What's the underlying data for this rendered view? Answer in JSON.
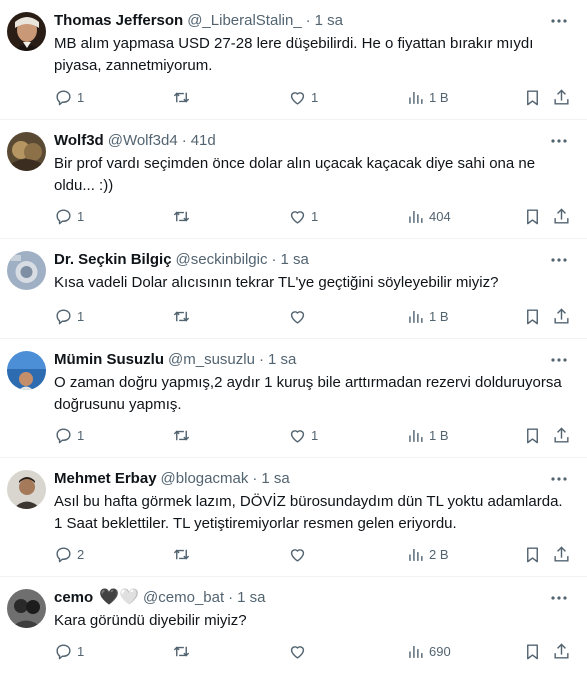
{
  "tweets": [
    {
      "name": "Thomas Jefferson",
      "handle": "@_LiberalStalin_",
      "time": "1 sa",
      "text": "MB alım yapmasa USD 27-28 lere düşebilirdi. He o fiyattan bırakır mıydı piyasa, zannetmiyorum.",
      "replies": "1",
      "retweets": "",
      "likes": "1",
      "views": "1 B"
    },
    {
      "name": "Wolf3d",
      "handle": "@Wolf3d4",
      "time": "41d",
      "text": "Bir prof vardı seçimden önce dolar alın uçacak kaçacak diye sahi ona ne oldu... :))",
      "replies": "1",
      "retweets": "",
      "likes": "1",
      "views": "404"
    },
    {
      "name": "Dr. Seçkin Bilgiç",
      "handle": "@seckinbilgic",
      "time": "1 sa",
      "text": "Kısa vadeli Dolar alıcısının tekrar TL'ye geçtiğini söyleyebilir miyiz?",
      "replies": "1",
      "retweets": "",
      "likes": "",
      "views": "1 B"
    },
    {
      "name": "Mümin Susuzlu",
      "handle": "@m_susuzlu",
      "time": "1 sa",
      "text": "O zaman doğru yapmış,2 aydır 1 kuruş bile arttırmadan rezervi dolduruyorsa doğrusunu yapmış.",
      "replies": "1",
      "retweets": "",
      "likes": "1",
      "views": "1 B"
    },
    {
      "name": "Mehmet Erbay",
      "handle": "@blogacmak",
      "time": "1 sa",
      "text": "Asıl bu hafta görmek lazım, DÖVİZ bürosundaydım dün TL yoktu adamlarda. 1 Saat beklettiler. TL yetiştiremiyorlar resmen gelen eriyordu.",
      "replies": "2",
      "retweets": "",
      "likes": "",
      "views": "2 B"
    },
    {
      "name": "cemo",
      "handle": "@cemo_bat",
      "time": "1 sa",
      "text": "Kara göründü diyebilir miyiz?",
      "replies": "1",
      "retweets": "",
      "likes": "",
      "views": "690"
    }
  ],
  "name_emoji": {
    "black_heart": "🖤",
    "white_heart": "🤍"
  },
  "icons": {
    "more": "more-icon",
    "reply": "reply-icon",
    "retweet": "retweet-icon",
    "like": "heart-icon",
    "views": "views-icon",
    "bookmark": "bookmark-icon",
    "share": "share-icon"
  },
  "colors": {
    "text": "#0f1419",
    "secondary": "#536471",
    "divider": "#eff3f4"
  }
}
